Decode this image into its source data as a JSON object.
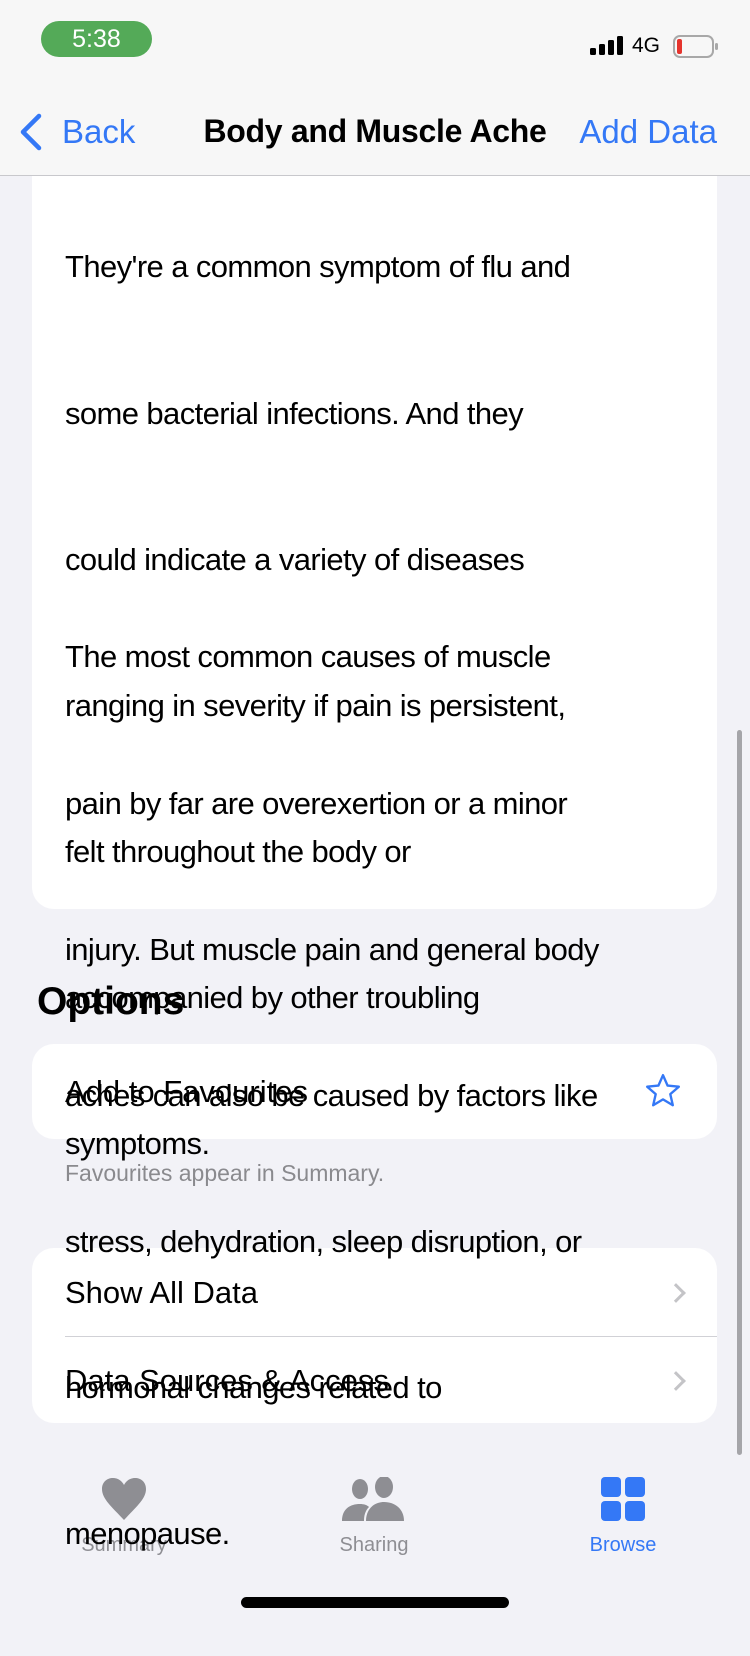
{
  "status_bar": {
    "time": "5:38",
    "network": "4G",
    "battery_level": 0.1
  },
  "nav": {
    "back_label": "Back",
    "title": "Body and Muscle Ache",
    "add_data_label": "Add Data"
  },
  "about": {
    "paragraph1_lines": [
      "They're a common symptom of flu and",
      "some bacterial infections. And they",
      "could indicate a variety of diseases",
      "ranging in severity if pain is persistent,",
      "felt throughout the body or",
      "accompanied by other troubling",
      "symptoms."
    ],
    "paragraph2_lines": [
      "The most common causes of muscle",
      "pain by far are overexertion or a minor",
      "injury. But muscle pain and general body",
      "aches can also be caused by factors like",
      "stress, dehydration, sleep disruption, or",
      "hormonal changes related to",
      "menopause."
    ]
  },
  "options": {
    "header": "Options",
    "add_favourites": "Add to Favourites",
    "favourites_footnote": "Favourites appear in Summary.",
    "show_all_data": "Show All Data",
    "data_sources": "Data Sources & Access"
  },
  "tab_bar": {
    "tabs": [
      {
        "label": "Summary",
        "icon": "heart-icon"
      },
      {
        "label": "Sharing",
        "icon": "people-icon"
      },
      {
        "label": "Browse",
        "icon": "grid-icon",
        "active": true
      }
    ]
  },
  "colors": {
    "accent": "#3478f6",
    "time_pill": "#54aa58",
    "inactive": "#8e8e93"
  }
}
